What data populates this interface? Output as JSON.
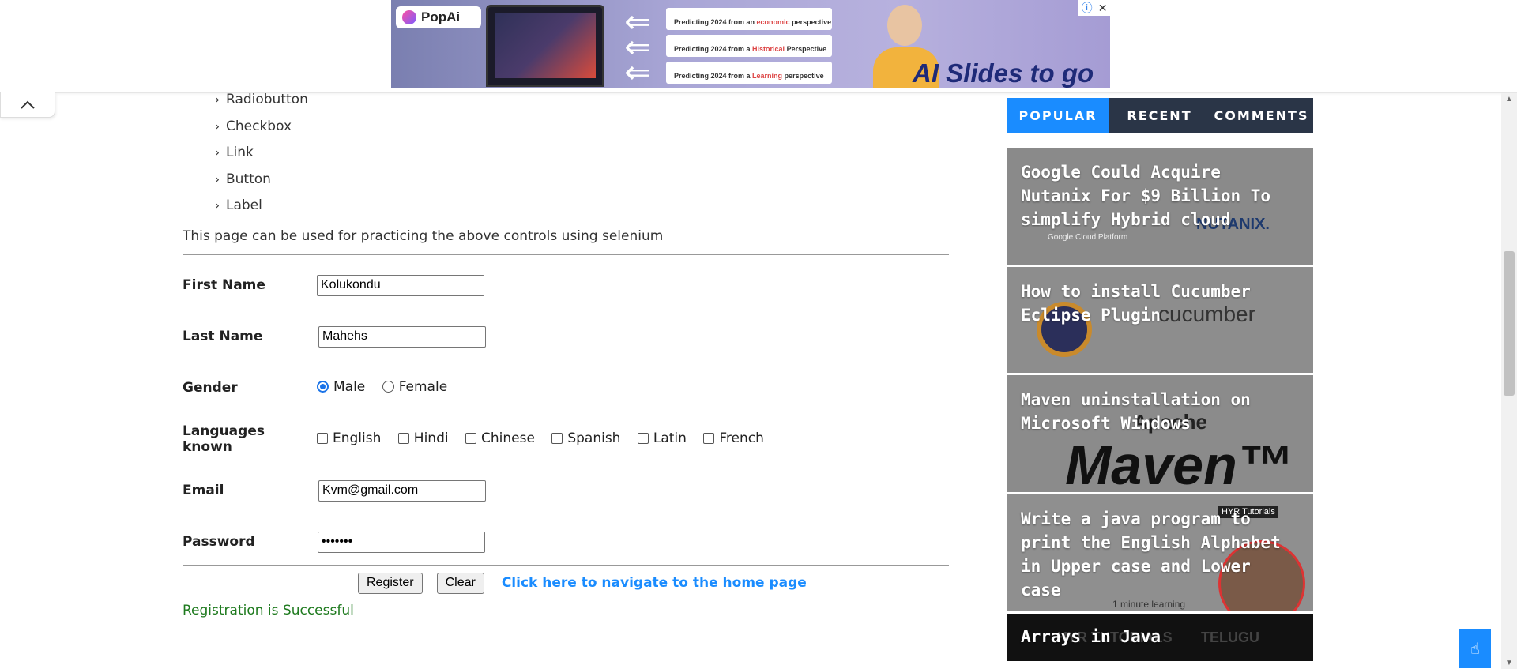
{
  "ad": {
    "brand": "PopAi",
    "card_prefix": "Predicting 2024 from",
    "cards": [
      {
        "pre": "Predicting 2024 from an ",
        "hl": "economic",
        "post": " perspective"
      },
      {
        "pre": "Predicting 2024 from a ",
        "hl": "Historical",
        "post": " Perspective"
      },
      {
        "pre": "Predicting 2024 from a ",
        "hl": "Learning",
        "post": " perspective"
      }
    ],
    "tagline": "AI Slides to go",
    "info_icon": "ⓘ",
    "close_icon": "✕"
  },
  "toc": {
    "items": [
      "Radiobutton",
      "Checkbox",
      "Link",
      "Button",
      "Label"
    ]
  },
  "intro": "This page can be used for practicing the above controls using selenium",
  "form": {
    "first_name": {
      "label": "First Name",
      "value": "Kolukondu"
    },
    "last_name": {
      "label": "Last Name",
      "value": "Mahehs"
    },
    "gender": {
      "label": "Gender",
      "options": [
        "Male",
        "Female"
      ],
      "selected": "Male"
    },
    "languages": {
      "label": "Languages known",
      "options": [
        "English",
        "Hindi",
        "Chinese",
        "Spanish",
        "Latin",
        "French"
      ]
    },
    "email": {
      "label": "Email",
      "value": "Kvm@gmail.com"
    },
    "password": {
      "label": "Password",
      "value": "•••••••"
    }
  },
  "actions": {
    "register": "Register",
    "clear": "Clear",
    "home_link": "Click here to navigate to the home page"
  },
  "status": "Registration is Successful",
  "sidebar": {
    "tabs": [
      "POPULAR",
      "RECENT",
      "COMMENTS"
    ],
    "active_tab": "POPULAR",
    "posts": [
      {
        "title": "Google Could Acquire Nutanix For $9 Billion To simplify Hybrid cloud",
        "art1": "Google Cloud Platform",
        "art2": "NUTANIX."
      },
      {
        "title": "How to install Cucumber Eclipse Plugin",
        "art1": "cucumber"
      },
      {
        "title": "Maven uninstallation on Microsoft Windows",
        "art1": "Apache",
        "art2": "Maven™"
      },
      {
        "title": "Write a java program to print the English Alphabet in Upper case and Lower case",
        "art1": "1 minute learning",
        "art2": "HYR Tutorials"
      },
      {
        "title": "Arrays in Java",
        "art1": "HYR TUTORIALS",
        "art2": "TELUGU"
      }
    ]
  },
  "colors": {
    "accent": "#1a8cff",
    "tab_dark": "#2a3547",
    "success": "#1e7a1e",
    "link": "#1a8cff"
  }
}
